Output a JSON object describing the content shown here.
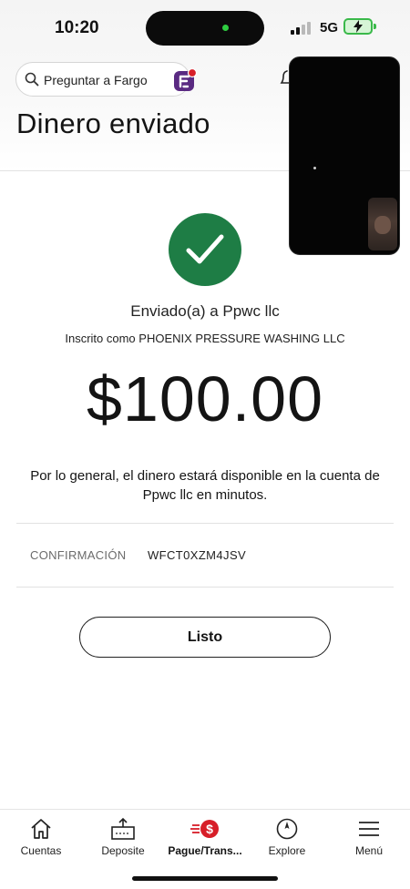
{
  "status_bar": {
    "time": "10:20",
    "network": "5G",
    "battery_state": "charging",
    "signal_bars_active": 2
  },
  "header": {
    "search_label": "Preguntar a Fargo",
    "title": "Dinero enviado",
    "icons": [
      "search-icon",
      "fargo-assistant-icon",
      "bell-icon"
    ]
  },
  "confirmation": {
    "status_icon": "check-icon",
    "sent_to": "Enviado(a) a Ppwc llc",
    "enrolled_as": "Inscrito como PHOENIX PRESSURE WASHING LLC",
    "amount": "$100.00",
    "availability_note": "Por lo general, el dinero estará disponible en la cuenta de Ppwc llc en minutos.",
    "confirmation_label": "CONFIRMACIÓN",
    "confirmation_number": "WFCT0XZM4JSV",
    "done_label": "Listo"
  },
  "tabbar": {
    "items": [
      {
        "label": "Cuentas",
        "icon": "home-icon",
        "active": false
      },
      {
        "label": "Deposite",
        "icon": "deposit-icon",
        "active": false
      },
      {
        "label": "Pague/Trans...",
        "icon": "pay-transfer-icon",
        "active": true
      },
      {
        "label": "Explore",
        "icon": "compass-icon",
        "active": false
      },
      {
        "label": "Menú",
        "icon": "hamburger-menu-icon",
        "active": false
      }
    ]
  },
  "colors": {
    "success_green": "#1e7d45",
    "brand_red": "#d71e28",
    "fargo_purple": "#5a2a82",
    "battery_green": "#3ab94a"
  }
}
